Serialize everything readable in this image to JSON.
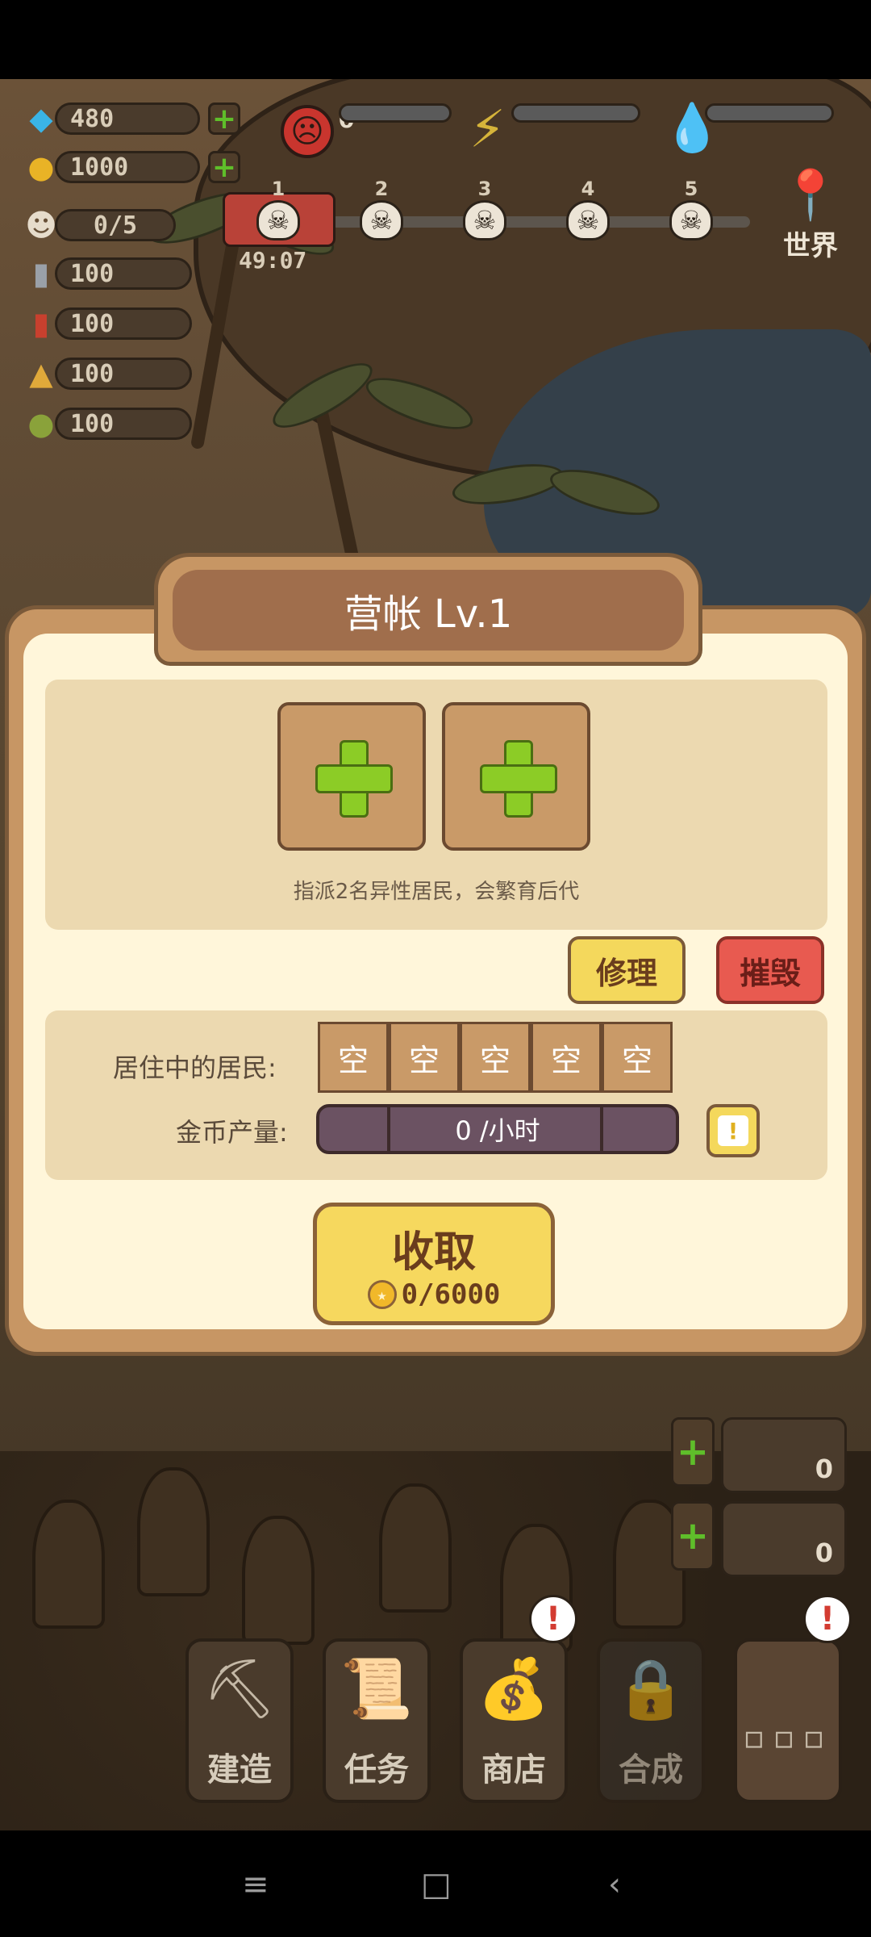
{
  "resources": {
    "diamonds": "480",
    "gold": "1000",
    "population": "0/5",
    "ammo_1": "100",
    "ammo_2": "100",
    "ammo_3": "100",
    "ammo_4": "100"
  },
  "status": {
    "mood_value": "0"
  },
  "waves": {
    "labels": [
      "1",
      "2",
      "3",
      "4",
      "5"
    ],
    "timer": "49:07"
  },
  "world_label": "世界",
  "modal": {
    "title": "营帐 Lv.1",
    "breed_hint": "指派2名异性居民，会繁育后代",
    "repair_label": "修理",
    "destroy_label": "摧毁",
    "residents_label": "居住中的居民:",
    "resident_slots": [
      "空",
      "空",
      "空",
      "空",
      "空"
    ],
    "gold_output_label": "金币产量:",
    "gold_output_value": "0 /小时",
    "info_icon": "!",
    "collect_label": "收取",
    "collect_amount": "0/6000"
  },
  "side_counters": [
    "0",
    "0"
  ],
  "toolbar": {
    "build": "建造",
    "tasks": "任务",
    "shop": "商店",
    "craft": "合成",
    "more": "▫▫▫"
  },
  "icons": {
    "diamond": "diamond-icon",
    "coin": "coin-icon",
    "sad_face": "sad-face-icon",
    "lightning": "lightning-icon",
    "water": "water-drop-icon",
    "skull": "skull-icon",
    "map_pin": "map-pin-icon"
  },
  "colors": {
    "panel_bg": "#fff6da",
    "panel_border": "#c79664",
    "add_plus": "#8ccc26",
    "repair_btn": "#f4d85c",
    "destroy_btn": "#e85a50",
    "collect_btn": "#f6d85e"
  }
}
